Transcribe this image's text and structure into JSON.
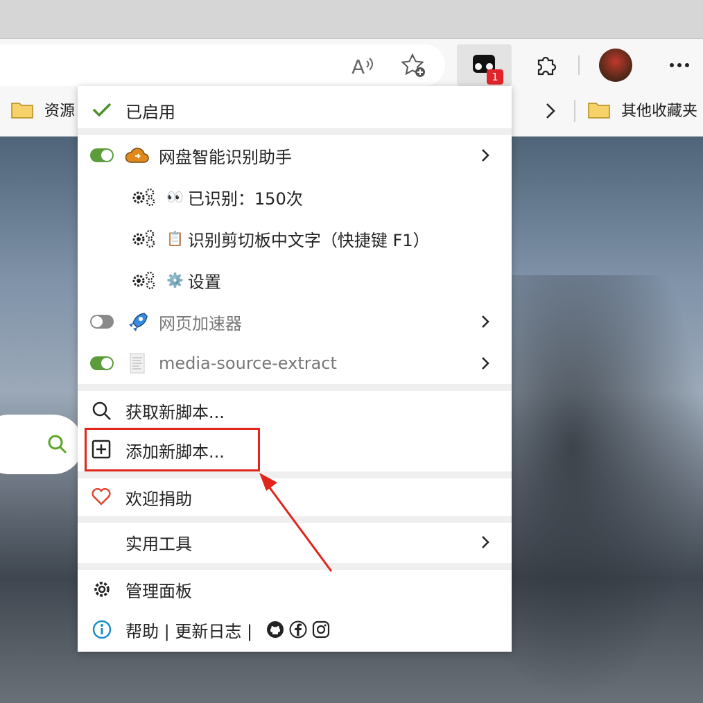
{
  "browser": {
    "bookmark_left": "资源",
    "bookmark_right": "其他收藏夹",
    "ext_badge": "1"
  },
  "menu": {
    "enabled_label": "已启用",
    "scripts": [
      {
        "name": "网盘智能识别助手",
        "enabled": true
      },
      {
        "name": "网页加速器",
        "enabled": false
      },
      {
        "name": "media-source-extract",
        "enabled": true
      }
    ],
    "commands": [
      {
        "emoji": "👀",
        "label": "已识别：150次"
      },
      {
        "emoji": "📋",
        "label": "识别剪切板中文字（快捷键 F1）"
      },
      {
        "emoji": "⚙️",
        "label": "设置"
      }
    ],
    "get_new_script": "获取新脚本...",
    "add_new_script": "添加新脚本...",
    "donate": "欢迎捐助",
    "tools": "实用工具",
    "dashboard": "管理面板",
    "footer": "帮助 | 更新日志 |"
  },
  "colors": {
    "toggle_on": "#5b9c3b",
    "toggle_off": "#8a8a8a",
    "check": "#4e8f2f",
    "heart": "#e1452d",
    "info": "#1a8fc1",
    "highlight": "#e1251b",
    "badge": "#e0242a"
  }
}
